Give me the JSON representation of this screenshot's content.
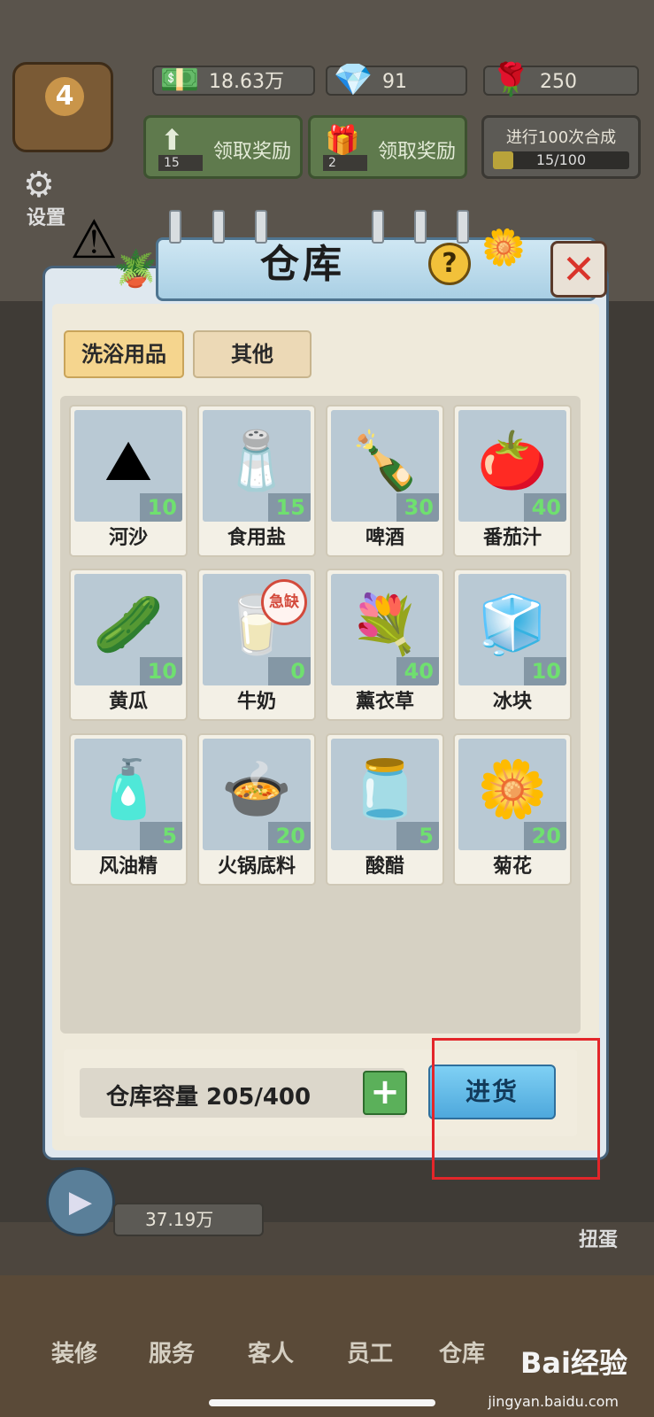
{
  "hud": {
    "money": "18.63万",
    "gems": "91",
    "roses": "250",
    "level": "4",
    "settings_label": "设置",
    "reward1": {
      "label": "领取奖励",
      "count": "15"
    },
    "reward2": {
      "label": "领取奖励",
      "count": "2"
    },
    "merge": {
      "title": "进行100次合成",
      "progress_text": "15/100",
      "progress": 0.15
    }
  },
  "modal": {
    "title": "仓库",
    "tabs": [
      {
        "label": "洗浴用品",
        "active": true
      },
      {
        "label": "其他",
        "active": false
      }
    ],
    "items": [
      {
        "name": "河沙",
        "qty": "10",
        "icon": "sand-pile-icon",
        "glyph": "⛰"
      },
      {
        "name": "食用盐",
        "qty": "15",
        "icon": "salt-bag-icon",
        "glyph": "🧂"
      },
      {
        "name": "啤酒",
        "qty": "30",
        "icon": "beer-bottle-icon",
        "glyph": "🍾"
      },
      {
        "name": "番茄汁",
        "qty": "40",
        "icon": "tomato-icon",
        "glyph": "🍅"
      },
      {
        "name": "黄瓜",
        "qty": "10",
        "icon": "cucumber-icon",
        "glyph": "🥒"
      },
      {
        "name": "牛奶",
        "qty": "0",
        "icon": "milk-carton-icon",
        "glyph": "🥛",
        "badge": "急缺"
      },
      {
        "name": "薰衣草",
        "qty": "40",
        "icon": "lavender-icon",
        "glyph": "💐"
      },
      {
        "name": "冰块",
        "qty": "10",
        "icon": "ice-cube-icon",
        "glyph": "🧊"
      },
      {
        "name": "风油精",
        "qty": "5",
        "icon": "oil-bottle-icon",
        "glyph": "🧴"
      },
      {
        "name": "火锅底料",
        "qty": "20",
        "icon": "hotpot-base-icon",
        "glyph": "🍲"
      },
      {
        "name": "酸醋",
        "qty": "5",
        "icon": "vinegar-jug-icon",
        "glyph": "🫙"
      },
      {
        "name": "菊花",
        "qty": "20",
        "icon": "chrysanthemum-icon",
        "glyph": "🌼"
      }
    ],
    "capacity_label": "仓库容量 205/400",
    "plus_label": "+",
    "restock_label": "进货"
  },
  "bottom": {
    "video_money": "37.19万",
    "gacha_label": "扭蛋",
    "nav": [
      "装修",
      "服务",
      "客人",
      "员工",
      "仓库"
    ]
  },
  "watermark": {
    "brand": "Bai经验",
    "url": "jingyan.baidu.com"
  }
}
